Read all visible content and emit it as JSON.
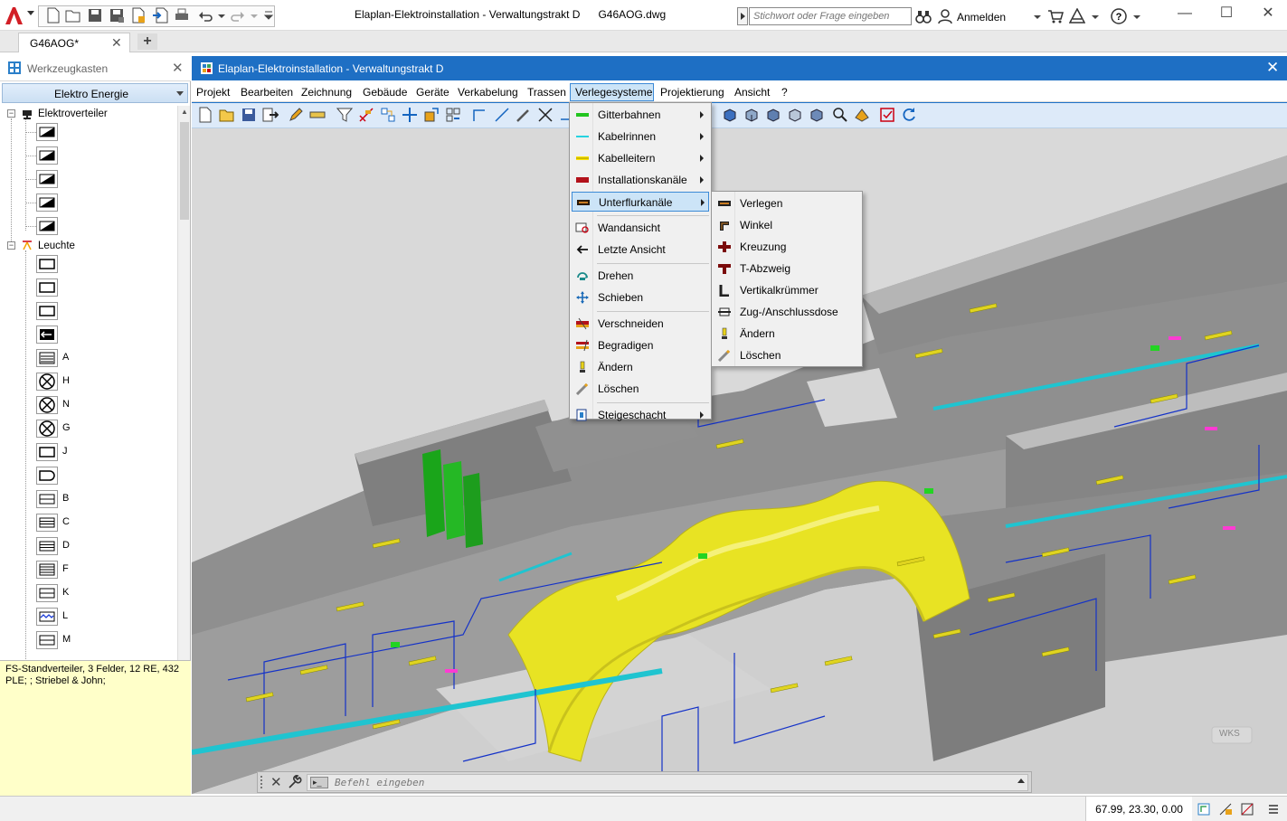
{
  "app": {
    "title": "Elaplan-Elektroinstallation - Verwaltungstrakt D      G46AOG.dwg",
    "search_placeholder": "Stichwort oder Frage eingeben",
    "signin_label": "Anmelden"
  },
  "tabs": {
    "doc_tab_label": "G46AOG*",
    "close_glyph": "✕",
    "new_tab_glyph": "+"
  },
  "toolbox": {
    "title": "Werkzeugkasten",
    "category": "Elektro Energie",
    "groups": {
      "verteiler": "Elektroverteiler",
      "leuchte": "Leuchte"
    },
    "leuchte_labels": [
      "",
      "",
      "",
      "",
      "A",
      "H",
      "N",
      "G",
      "J",
      "",
      "B",
      "C",
      "D",
      "F",
      "K",
      "L",
      "M"
    ],
    "info_text": "FS-Standverteiler,  3 Felder,  12 RE, 432 PLE; ; Striebel & John;"
  },
  "inner_window": {
    "title": "Elaplan-Elektroinstallation - Verwaltungstrakt D",
    "close_glyph": "✕"
  },
  "menubar": {
    "items": [
      "Projekt",
      "Bearbeiten",
      "Zeichnung",
      "Gebäude",
      "Geräte",
      "Verkabelung",
      "Trassen",
      "Verlegesysteme",
      "Projektierung",
      "Ansicht",
      "?"
    ]
  },
  "menu_verlegesysteme": {
    "items": [
      {
        "label": "Gitterbahnen",
        "icon": "gitterbahn-icon",
        "color": "#22c51f"
      },
      {
        "label": "Kabelrinnen",
        "icon": "kabelrinne-icon",
        "color": "#27d3e0"
      },
      {
        "label": "Kabelleitern",
        "icon": "kabelleiter-icon",
        "color": "#ffe600"
      },
      {
        "label": "Installationskanäle",
        "icon": "installationskanal-icon",
        "color": "#b3121b"
      },
      {
        "label": "Unterflurkanäle",
        "icon": "unterflurkanal-icon",
        "color": "#2a1a0a"
      },
      {
        "label": "Wandansicht",
        "icon": "wandansicht-icon"
      },
      {
        "label": "Letzte Ansicht",
        "icon": "back-arrow-icon"
      },
      {
        "label": "Drehen",
        "icon": "rotate-icon"
      },
      {
        "label": "Schieben",
        "icon": "move-icon"
      },
      {
        "label": "Verschneiden",
        "icon": "cut-icon"
      },
      {
        "label": "Begradigen",
        "icon": "straighten-icon"
      },
      {
        "label": "Ändern",
        "icon": "edit-icon"
      },
      {
        "label": "Löschen",
        "icon": "eraser-icon"
      },
      {
        "label": "Steigeschacht",
        "icon": "shaft-icon"
      }
    ]
  },
  "menu_unterflur": {
    "items": [
      {
        "label": "Verlegen",
        "icon": "lay-icon"
      },
      {
        "label": "Winkel",
        "icon": "angle-icon"
      },
      {
        "label": "Kreuzung",
        "icon": "cross-icon"
      },
      {
        "label": "T-Abzweig",
        "icon": "tee-icon"
      },
      {
        "label": "Vertikalkrümmer",
        "icon": "vertical-bend-icon"
      },
      {
        "label": "Zug-/Anschlussdose",
        "icon": "junction-box-icon"
      },
      {
        "label": "Ändern",
        "icon": "edit-icon"
      },
      {
        "label": "Löschen",
        "icon": "eraser-icon"
      }
    ]
  },
  "viewport": {
    "wcs_label": "WKS"
  },
  "cmdline": {
    "placeholder": "Befehl eingeben",
    "prompt_glyph": "▸_"
  },
  "status": {
    "coords": "67.99, 23.30, 0.00"
  },
  "colors": {
    "accent": "#1e6fc4",
    "menu_highlight": "#cce4f7",
    "viewport_bg": "#d8d8d8",
    "info_bg": "#ffffc9"
  }
}
